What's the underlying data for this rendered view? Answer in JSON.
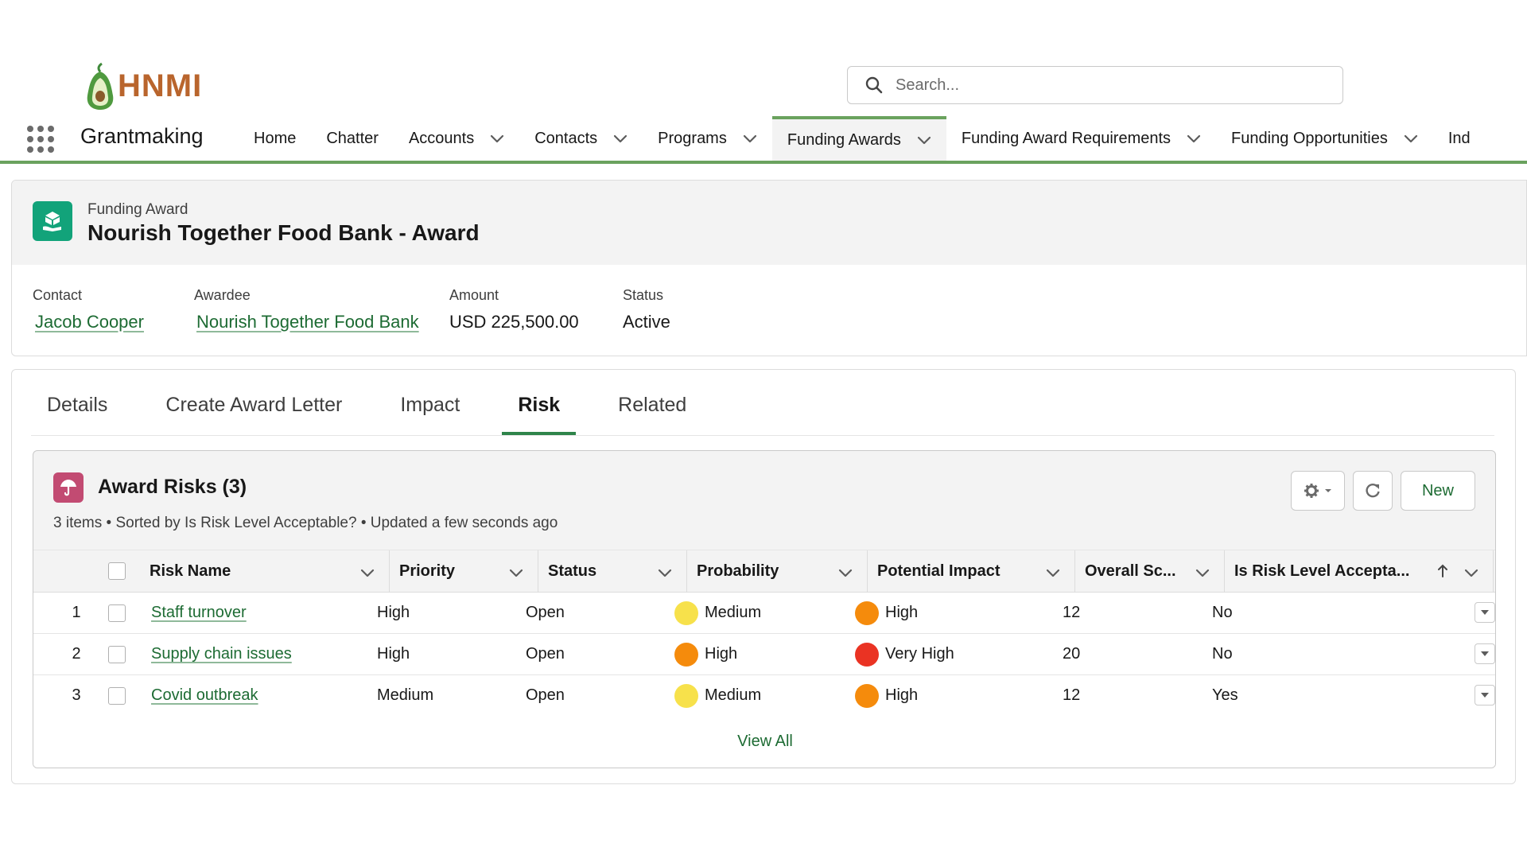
{
  "brand": {
    "logo_text": "HNMI",
    "app_name": "Grantmaking",
    "accent": "#6aa25e"
  },
  "search": {
    "placeholder": "Search..."
  },
  "nav": {
    "items": [
      {
        "label": "Home",
        "has_menu": false,
        "active": false
      },
      {
        "label": "Chatter",
        "has_menu": false,
        "active": false
      },
      {
        "label": "Accounts",
        "has_menu": true,
        "active": false
      },
      {
        "label": "Contacts",
        "has_menu": true,
        "active": false
      },
      {
        "label": "Programs",
        "has_menu": true,
        "active": false
      },
      {
        "label": "Funding Awards",
        "has_menu": true,
        "active": true
      },
      {
        "label": "Funding Award Requirements",
        "has_menu": true,
        "active": false
      },
      {
        "label": "Funding Opportunities",
        "has_menu": true,
        "active": false
      },
      {
        "label": "Ind",
        "has_menu": false,
        "active": false
      }
    ]
  },
  "record": {
    "type": "Funding Award",
    "title": "Nourish Together Food Bank - Award",
    "icon": "funding-award-icon",
    "fields": [
      {
        "label": "Contact",
        "value": "Jacob Cooper",
        "link": true
      },
      {
        "label": "Awardee",
        "value": "Nourish Together Food Bank",
        "link": true
      },
      {
        "label": "Amount",
        "value": "USD 225,500.00",
        "link": false
      },
      {
        "label": "Status",
        "value": "Active",
        "link": false
      }
    ]
  },
  "tabs": [
    "Details",
    "Create Award Letter",
    "Impact",
    "Risk",
    "Related"
  ],
  "active_tab": "Risk",
  "related_list": {
    "title": "Award Risks (3)",
    "icon": "umbrella-icon",
    "meta": "3 items • Sorted by Is Risk Level Acceptable? • Updated a few seconds ago",
    "new_label": "New",
    "columns": [
      "Risk Name",
      "Priority",
      "Status",
      "Probability",
      "Potential Impact",
      "Overall Sc...",
      "Is Risk Level Accepta..."
    ],
    "rows": [
      {
        "num": "1",
        "name": "Staff turnover",
        "priority": "High",
        "status": "Open",
        "probability": "Medium",
        "probability_color": "#f7e14b",
        "impact": "High",
        "impact_color": "#f58b0c",
        "score": "12",
        "acceptable": "No"
      },
      {
        "num": "2",
        "name": "Supply chain issues",
        "priority": "High",
        "status": "Open",
        "probability": "High",
        "probability_color": "#f58b0c",
        "impact": "Very High",
        "impact_color": "#ea3323",
        "score": "20",
        "acceptable": "No"
      },
      {
        "num": "3",
        "name": "Covid outbreak",
        "priority": "Medium",
        "status": "Open",
        "probability": "Medium",
        "probability_color": "#f7e14b",
        "impact": "High",
        "impact_color": "#f58b0c",
        "score": "12",
        "acceptable": "Yes"
      }
    ],
    "view_all": "View All"
  }
}
